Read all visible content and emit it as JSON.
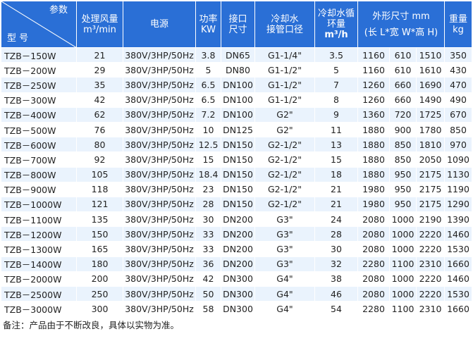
{
  "headers": {
    "param": "参数",
    "model": "型 号",
    "airflow_l1": "处理风量",
    "airflow_l2": "m³/min",
    "power_supply": "电源",
    "power_l1": "功率",
    "power_l2": "KW",
    "port_l1": "接口",
    "port_l2": "尺寸",
    "coolpipe_l1": "冷却水",
    "coolpipe_l2": "接管口径",
    "circ_l1": "冷却水循",
    "circ_l2": "环量",
    "circ_l3": "m³/h",
    "dims_l1": "外形尺寸 mm",
    "dims_l2": "(长 L*宽 W*高 H)",
    "weight_l1": "重量",
    "weight_l2": "kg"
  },
  "rows": [
    {
      "model": "TZB－150W",
      "airflow": "21",
      "power_supply": "380V/3HP/50Hz",
      "power": "3.8",
      "port": "DN65",
      "coolpipe": "G1-1/4\"",
      "circ": "3.5",
      "L": "1160",
      "W": "610",
      "H": "1510",
      "weight": "350"
    },
    {
      "model": "TZB－200W",
      "airflow": "29",
      "power_supply": "380V/3HP/50Hz",
      "power": "5",
      "port": "DN80",
      "coolpipe": "G1-1/2\"",
      "circ": "5",
      "L": "1160",
      "W": "610",
      "H": "1610",
      "weight": "430"
    },
    {
      "model": "TZB－250W",
      "airflow": "35",
      "power_supply": "380V/3HP/50Hz",
      "power": "6.5",
      "port": "DN100",
      "coolpipe": "G1-1/2\"",
      "circ": "7",
      "L": "1260",
      "W": "660",
      "H": "1690",
      "weight": "470"
    },
    {
      "model": "TZB－300W",
      "airflow": "42",
      "power_supply": "380V/3HP/50Hz",
      "power": "6.5",
      "port": "DN100",
      "coolpipe": "G1-1/2\"",
      "circ": "8",
      "L": "1260",
      "W": "660",
      "H": "1490",
      "weight": "490"
    },
    {
      "model": "TZB－400W",
      "airflow": "62",
      "power_supply": "380V/3HP/50Hz",
      "power": "7.2",
      "port": "DN100",
      "coolpipe": "G2\"",
      "circ": "9",
      "L": "1360",
      "W": "720",
      "H": "1725",
      "weight": "670"
    },
    {
      "model": "TZB－500W",
      "airflow": "76",
      "power_supply": "380V/3HP/50Hz",
      "power": "10",
      "port": "DN125",
      "coolpipe": "G2\"",
      "circ": "11",
      "L": "1880",
      "W": "900",
      "H": "1780",
      "weight": "850"
    },
    {
      "model": "TZB－600W",
      "airflow": "80",
      "power_supply": "380V/3HP/50Hz",
      "power": "12.5",
      "port": "DN150",
      "coolpipe": "G2-1/2\"",
      "circ": "13",
      "L": "1880",
      "W": "850",
      "H": "1810",
      "weight": "970"
    },
    {
      "model": "TZB－700W",
      "airflow": "92",
      "power_supply": "380V/3HP/50Hz",
      "power": "15",
      "port": "DN150",
      "coolpipe": "G2-1/2\"",
      "circ": "15",
      "L": "1880",
      "W": "850",
      "H": "2050",
      "weight": "1090"
    },
    {
      "model": "TZB－800W",
      "airflow": "105",
      "power_supply": "380V/3HP/50Hz",
      "power": "18.4",
      "port": "DN150",
      "coolpipe": "G2-1/2\"",
      "circ": "18",
      "L": "1880",
      "W": "950",
      "H": "2175",
      "weight": "1130"
    },
    {
      "model": "TZB－900W",
      "airflow": "118",
      "power_supply": "380V/3HP/50Hz",
      "power": "23",
      "port": "DN150",
      "coolpipe": "G2-1/2\"",
      "circ": "21",
      "L": "1980",
      "W": "950",
      "H": "2175",
      "weight": "1190"
    },
    {
      "model": "TZB－1000W",
      "airflow": "121",
      "power_supply": "380V/3HP/50Hz",
      "power": "28",
      "port": "DN150",
      "coolpipe": "G2-1/2\"",
      "circ": "21",
      "L": "1980",
      "W": "950",
      "H": "2175",
      "weight": "1290"
    },
    {
      "model": "TZB－1100W",
      "airflow": "135",
      "power_supply": "380V/3HP/50Hz",
      "power": "30",
      "port": "DN200",
      "coolpipe": "G3\"",
      "circ": "24",
      "L": "2080",
      "W": "1000",
      "H": "2190",
      "weight": "1390"
    },
    {
      "model": "TZB－1200W",
      "airflow": "150",
      "power_supply": "380V/3HP/50Hz",
      "power": "33",
      "port": "DN200",
      "coolpipe": "G3\"",
      "circ": "28",
      "L": "2080",
      "W": "1000",
      "H": "2220",
      "weight": "1460"
    },
    {
      "model": "TZB－1300W",
      "airflow": "165",
      "power_supply": "380V/3HP/50Hz",
      "power": "33",
      "port": "DN200",
      "coolpipe": "G3\"",
      "circ": "30",
      "L": "2080",
      "W": "1000",
      "H": "2220",
      "weight": "1530"
    },
    {
      "model": "TZB－1400W",
      "airflow": "180",
      "power_supply": "380V/3HP/50Hz",
      "power": "36",
      "port": "DN200",
      "coolpipe": "G3\"",
      "circ": "32",
      "L": "2280",
      "W": "1100",
      "H": "2310",
      "weight": "1660"
    },
    {
      "model": "TZB－2000W",
      "airflow": "200",
      "power_supply": "380V/3HP/50Hz",
      "power": "42",
      "port": "DN300",
      "coolpipe": "G4\"",
      "circ": "38",
      "L": "2080",
      "W": "1000",
      "H": "2220",
      "weight": "1460"
    },
    {
      "model": "TZB－2500W",
      "airflow": "250",
      "power_supply": "380V/3HP/50Hz",
      "power": "50",
      "port": "DN300",
      "coolpipe": "G4\"",
      "circ": "46",
      "L": "2080",
      "W": "1000",
      "H": "2220",
      "weight": "1530"
    },
    {
      "model": "TZB－3000W",
      "airflow": "300",
      "power_supply": "380V/3HP/50Hz",
      "power": "58",
      "port": "DN300",
      "coolpipe": "G4\"",
      "circ": "54",
      "L": "2280",
      "W": "1100",
      "H": "2310",
      "weight": "1660"
    }
  ],
  "note": "备注：产品由于不断改良，具体以实物为准。",
  "colors": {
    "header_bg": "#2a6fd6",
    "header_text": "#ffffff",
    "row_alt": "#eaf3fd"
  }
}
